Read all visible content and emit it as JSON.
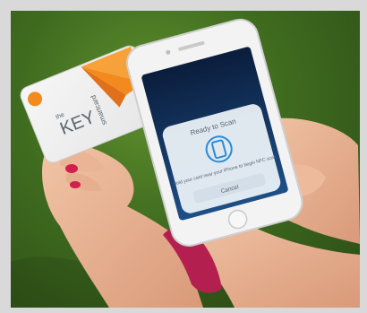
{
  "photo": {
    "card": {
      "brand_prefix": "the",
      "brand_name": "KEY",
      "brand_suffix": "smartcard"
    },
    "phone": {
      "sheet_title": "Ready to Scan",
      "sheet_instruction": "Hold your card near your iPhone to begin NFC scan",
      "cancel_label": "Cancel"
    },
    "colors": {
      "grass": "#4f7f27",
      "card_orange": "#f28a1e",
      "wristband": "#b3204f",
      "nail_polish": "#d21f4d",
      "phone_screen": "#0f2a56"
    }
  }
}
